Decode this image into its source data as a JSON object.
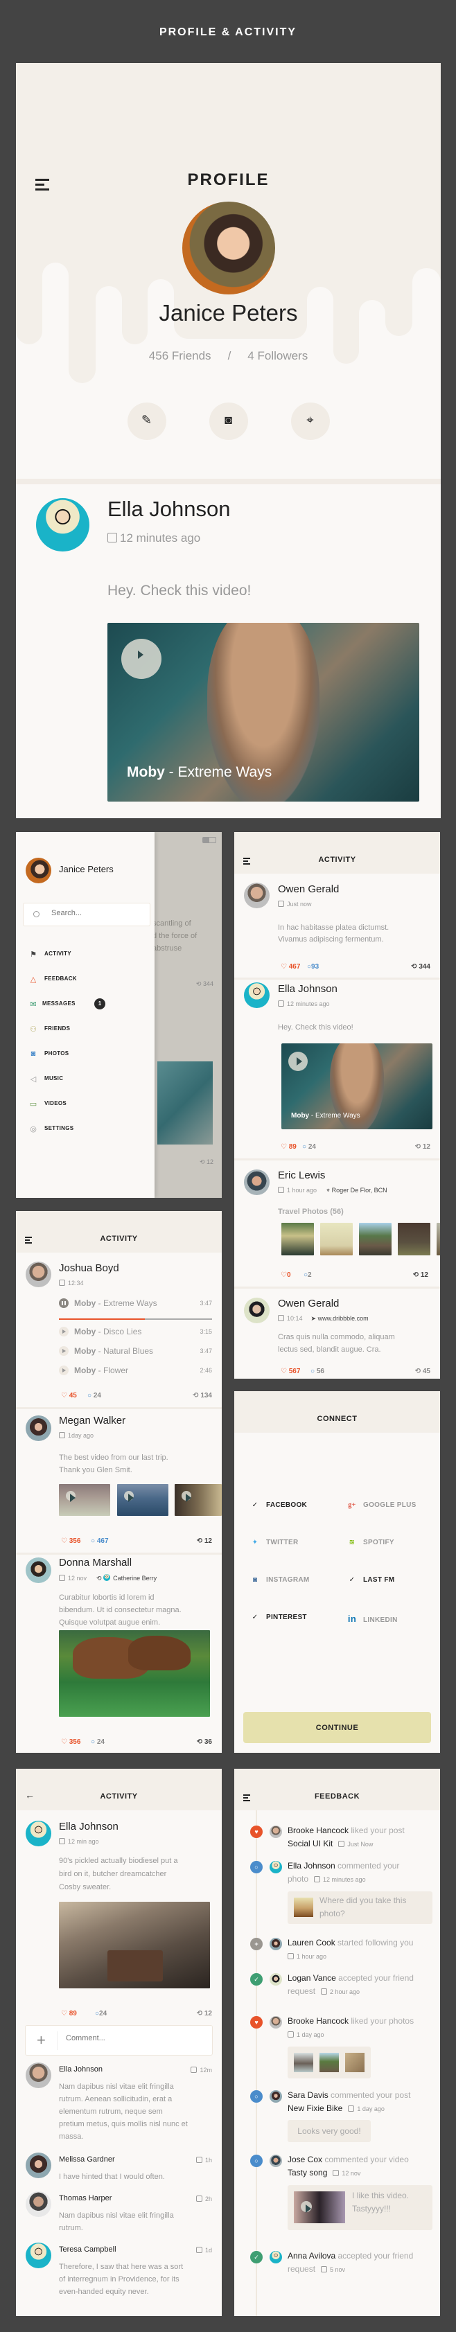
{
  "page": {
    "title": "PROFILE & ACTIVITY"
  },
  "profile": {
    "header_title": "PROFILE",
    "name": "Janice Peters",
    "friends": "456 Friends",
    "separator": "/",
    "followers": "4 Followers",
    "actions": [
      {
        "name": "edit",
        "icon": "✎"
      },
      {
        "name": "camera",
        "icon": "◙"
      },
      {
        "name": "location",
        "icon": "⌖"
      }
    ],
    "post": {
      "author": "Ella Johnson",
      "time": "12 minutes ago",
      "text": "Hey. Check this video!",
      "video_artist": "Moby",
      "video_title": " - Extreme Ways"
    }
  },
  "drawer": {
    "user": "Janice Peters",
    "search_placeholder": "Search...",
    "items": [
      {
        "label": "ACTIVITY",
        "icon": "⚑",
        "color": "#444444"
      },
      {
        "label": "FEEDBACK",
        "icon": "🔔",
        "color": "#e8532a"
      },
      {
        "label": "MESSAGES",
        "icon": "✉",
        "color": "#3a9a70",
        "badge": "1"
      },
      {
        "label": "FRIENDS",
        "icon": "⚇",
        "color": "#b8b070"
      },
      {
        "label": "PHOTOS",
        "icon": "◙",
        "color": "#4a8ccb"
      },
      {
        "label": "MUSIC",
        "icon": "◁",
        "color": "#999999"
      },
      {
        "label": "VIDEOS",
        "icon": "▭",
        "color": "#6a9a50"
      },
      {
        "label": "SETTINGS",
        "icon": "◎",
        "color": "#999999"
      }
    ],
    "bg_text": [
      "scantling of",
      "d the force of",
      "abstruse"
    ],
    "bg_reposts_1": "344",
    "bg_reposts_2": "12"
  },
  "activity_feed": {
    "header_title": "ACTIVITY",
    "posts": [
      {
        "author": "Owen Gerald",
        "time": "Just now",
        "text_1": "In hac habitasse platea dictumst.",
        "text_2": "Vivamus adipiscing fermentum.",
        "likes": "467",
        "comments": "93",
        "reposts": "344"
      },
      {
        "author": "Ella Johnson",
        "time": "12 minutes ago",
        "text_1": "Hey. Check this video!",
        "video_artist": "Moby",
        "video_title": " - Extreme Ways",
        "likes": "89",
        "comments": "24",
        "reposts": "12"
      },
      {
        "author": "Eric Lewis",
        "time": "1 hour ago",
        "location": "Roger De Flor, BCN",
        "album": "Travel Photos (56)",
        "likes": "0",
        "comments": "2",
        "reposts": "12"
      },
      {
        "author": "Owen Gerald",
        "time": "10:14",
        "link": "www.dribbble.com",
        "text_1": "Cras quis nulla commodo, aliquam",
        "text_2": "lectus sed, blandit augue. Cra.",
        "likes": "567",
        "comments": "56",
        "reposts": "45"
      }
    ]
  },
  "music_feed": {
    "header_title": "ACTIVITY",
    "post1": {
      "author": "Joshua Boyd",
      "time": "12:34",
      "playing_progress": 0.56,
      "tracks": [
        {
          "artist": "Moby",
          "title": " - Extreme Ways",
          "duration": "3:47",
          "playing": true
        },
        {
          "artist": "Moby",
          "title": " - Disco Lies",
          "duration": "3:15"
        },
        {
          "artist": "Moby",
          "title": " - Natural Blues",
          "duration": "3:47"
        },
        {
          "artist": "Moby",
          "title": " - Flower",
          "duration": "2:46"
        }
      ],
      "likes": "45",
      "comments": "24",
      "reposts": "134"
    },
    "post2": {
      "author": "Megan Walker",
      "time": "1day ago",
      "text_1": "The best video from our last trip.",
      "text_2": "Thank you Glen Smit.",
      "likes": "356",
      "comments": "467",
      "reposts": "12"
    },
    "post3": {
      "author": "Donna Marshall",
      "time": "12 nov",
      "shared_from": "Catherine Berry",
      "text_1": "Curabitur lobortis id lorem id",
      "text_2": "bibendum. Ut id consectetur magna.",
      "text_3": "Quisque volutpat augue enim.",
      "likes": "356",
      "comments": "24",
      "reposts": "36"
    }
  },
  "connect": {
    "header_title": "CONNECT",
    "services": [
      {
        "label": "FACEBOOK",
        "connected": true,
        "icon": "✓",
        "color": "#222222"
      },
      {
        "label": "GOOGLE PLUS",
        "connected": false,
        "icon": "g+",
        "color": "#dd4b39"
      },
      {
        "label": "TWITTER",
        "connected": false,
        "icon": "🐦",
        "color": "#3fa9e6"
      },
      {
        "label": "SPOTIFY",
        "connected": false,
        "icon": "≋",
        "color": "#7ab800"
      },
      {
        "label": "INSTAGRAM",
        "connected": false,
        "icon": "◙",
        "color": "#3f6b9a"
      },
      {
        "label": "LAST FM",
        "connected": true,
        "icon": "✓",
        "color": "#222222"
      },
      {
        "label": "PINTEREST",
        "connected": true,
        "icon": "✓",
        "color": "#222222"
      },
      {
        "label": "LINKEDIN",
        "connected": false,
        "icon": "in",
        "color": "#0e76b4"
      }
    ],
    "continue_label": "CONTINUE"
  },
  "detail": {
    "header_title": "ACTIVITY",
    "author": "Ella Johnson",
    "time": "12 min ago",
    "text_1": "90's pickled actually biodiesel put a",
    "text_2": "bird on it, butcher dreamcatcher",
    "text_3": "Cosby sweater.",
    "likes": "89",
    "comments": "24",
    "reposts": "12",
    "comment_placeholder": "Comment...",
    "comments_list": [
      {
        "name": "Ella Johnson",
        "time": "12m",
        "lines": [
          "Nam dapibus nisl vitae elit fringilla",
          "rutrum. Aenean sollicitudin, erat a",
          "elementum rutrum, neque sem",
          "pretium metus, quis mollis nisl nunc et",
          "massa."
        ]
      },
      {
        "name": "Melissa Gardner",
        "time": "1h",
        "lines": [
          "I have hinted that I would often."
        ]
      },
      {
        "name": "Thomas Harper",
        "time": "2h",
        "lines": [
          "Nam dapibus nisl vitae elit fringilla",
          "rutrum."
        ]
      },
      {
        "name": "Teresa Campbell",
        "time": "1d",
        "lines": [
          "Therefore, I saw that here was a sort",
          "of interregnum in Providence, for its",
          "even-handed equity never."
        ]
      }
    ]
  },
  "feedback": {
    "header_title": "FEEDBACK",
    "items": [
      {
        "user": "Brooke Hancock",
        "action": " liked your post",
        "object": "Social UI Kit",
        "time": "Just Now",
        "type": "like"
      },
      {
        "user": "Ella Johnson",
        "action": " commented your",
        "action2": "photo",
        "time": "12 minutes ago",
        "type": "comment",
        "quote": "Where did you take this photo?"
      },
      {
        "user": "Lauren Cook",
        "action": " started following you",
        "time": "1 hour ago",
        "type": "follow"
      },
      {
        "user": "Logan Vance",
        "action": " accepted your friend",
        "action2": "request",
        "time": "2 hour ago",
        "type": "accept"
      },
      {
        "user": "Brooke Hancock",
        "action": " liked your photos",
        "time": "1 day ago",
        "type": "like"
      },
      {
        "user": "Sara Davis",
        "action": " commented your post",
        "object": "New Fixie Bike",
        "time": "1 day ago",
        "type": "comment",
        "quote": "Looks very good!"
      },
      {
        "user": "Jose Cox",
        "action": " commented your video",
        "object": "Tasty song",
        "time": "12 nov",
        "type": "comment",
        "quote": "I like this video. Tastyyyy!!!"
      },
      {
        "user": "Anna Avilova",
        "action": " accepted your friend",
        "action2": "request",
        "time": "5 nov",
        "type": "accept"
      }
    ]
  },
  "colors": {
    "like": "#e8532a",
    "comment": "#4a8ccb",
    "follow": "#9a9690",
    "accept": "#3e9e72",
    "header_bg": "#f3efe9",
    "panel_bg": "#faf8f6",
    "page_bg": "#444444",
    "continue_bg": "#e6e1ad"
  }
}
